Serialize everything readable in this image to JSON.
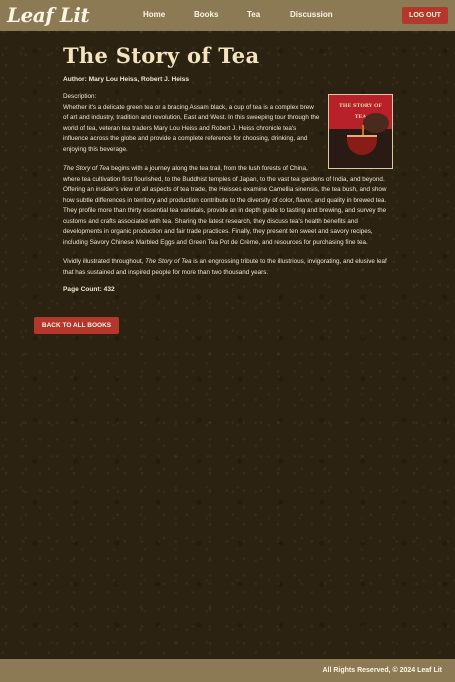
{
  "nav": {
    "logo": "Leaf Lit",
    "links": [
      "Home",
      "Books",
      "Tea",
      "Discussion"
    ],
    "logout_label": "LOG OUT"
  },
  "book": {
    "title": "The Story of Tea",
    "authors": "Author: Mary Lou Heiss, Robert J. Heiss",
    "description_label": "Description:",
    "cover_text": "THE STORY OF TEA",
    "para1": "Whether it's a delicate green tea or a bracing Assam black, a cup of tea is a complex brew of art and industry, tradition and revolution, East and West. In this sweeping tour through the world of tea, veteran tea traders Mary Lou Heiss and Robert J. Heiss chronicle tea's influence across the globe and provide a complete reference for choosing, drinking, and enjoying this beverage.",
    "para2_italic": "The Story of Tea",
    "para2": " begins with a journey along the tea trail, from the lush forests of China, where tea cultivation first flourished, to the Buddhist temples of Japan, to the vast tea gardens of India, and beyond. Offering an insider's view of all aspects of tea trade, the Heisses examine Camellia sinensis, the tea bush, and show how subtle differences in territory and production contribute to the diversity of color, flavor, and quality in brewed tea. They profile more than thirty essential tea varietals, provide an in depth guide to tasting and brewing, and survey the customs and crafts associated with tea. Sharing the latest research, they discuss tea's health benefits and developments in organic production and fair trade practices. Finally, they present ten sweet and savory recipes, including Savory Chinese Marbled Eggs and Green Tea Pot de Crème, and resources for purchasing fine tea.",
    "para3_start": "Vividly illustrated throughout, ",
    "para3_italic": "The Story of Tea",
    "para3_end": " is an engrossing tribute to the illustrious, invigorating, and elusive leaf that has sustained and inspired people for more than two thousand years.",
    "page_count": "Page Count: 432"
  },
  "back_label": "BACK TO ALL BOOKS",
  "footer": "All Rights Reserved, © 2024 Leaf Lit",
  "colors": {
    "nav_bg": "#8c7a55",
    "accent_red": "#b5362a",
    "page_bg": "#2b2212",
    "title_text": "#f3e4bf"
  }
}
